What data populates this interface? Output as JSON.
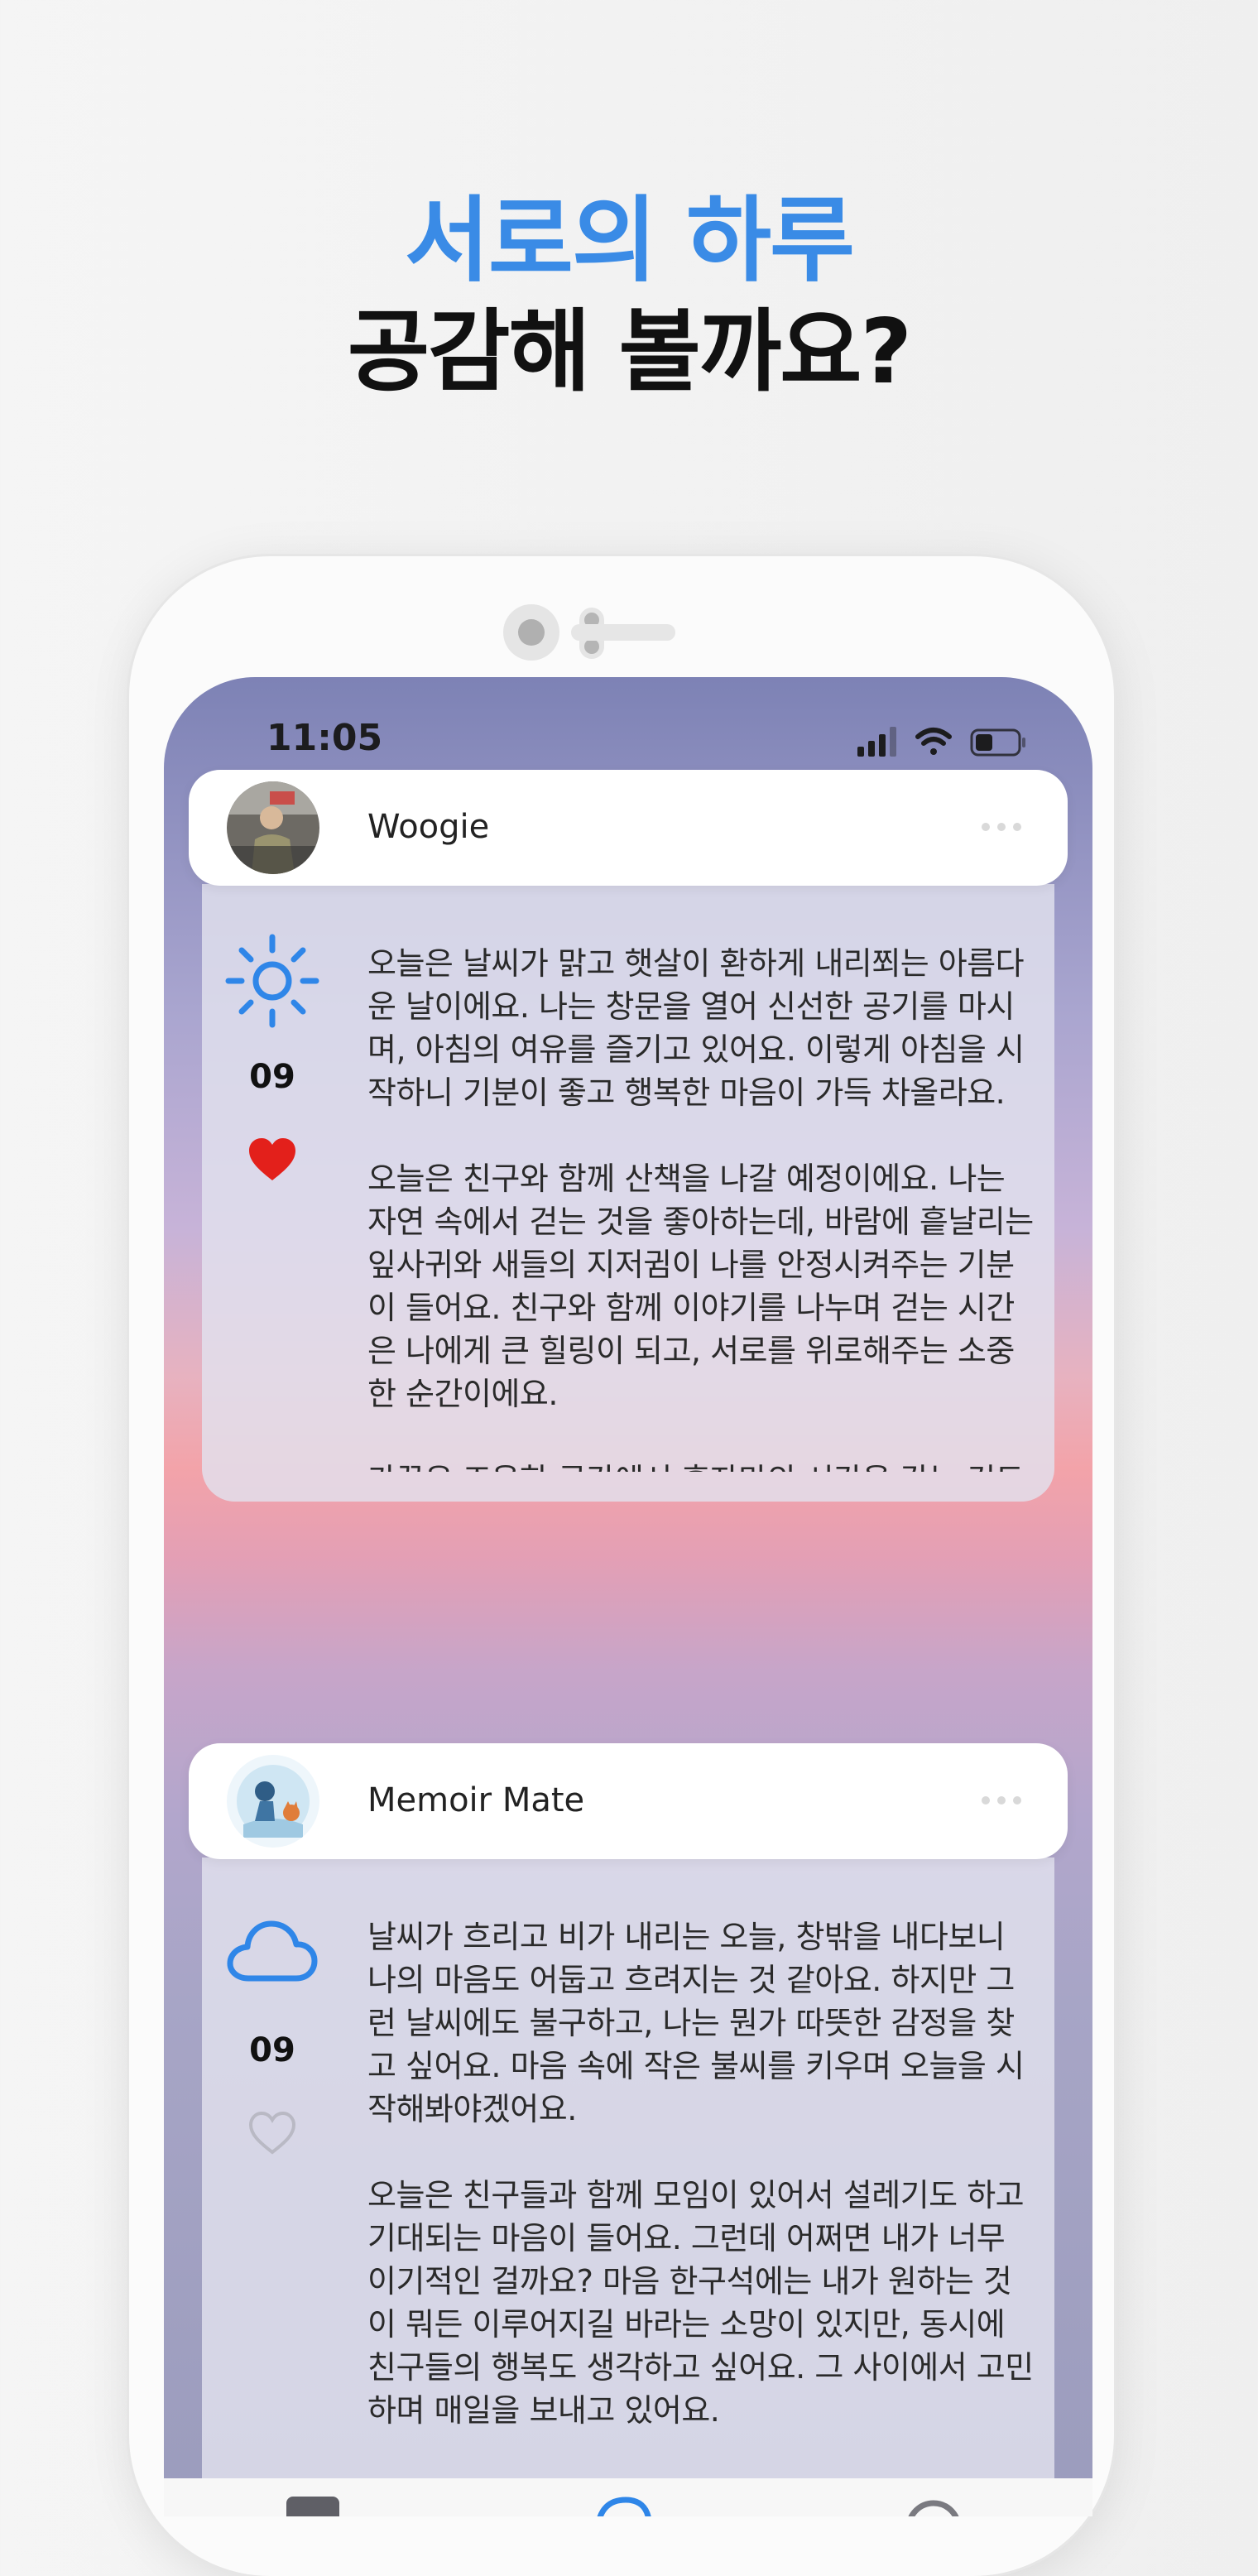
{
  "headline": {
    "line1": "서로의 하루",
    "line2": "공감해 볼까요?"
  },
  "status_bar": {
    "time": "11:05"
  },
  "posts": [
    {
      "author": "Woogie",
      "weather": "sun-icon",
      "day": "09",
      "liked": true,
      "text": "오늘은 날씨가 맑고 햇살이 환하게 내리쬐는 아름다운 날이에요. 나는 창문을 열어 신선한 공기를 마시며, 아침의 여유를 즐기고 있어요. 이렇게 아침을 시작하니 기분이 좋고 행복한 마음이 가득 차올라요.\n\n오늘은 친구와 함께 산책을 나갈 예정이에요. 나는 자연 속에서 걷는 것을 좋아하는데, 바람에 흩날리는 잎사귀와 새들의 지저귐이 나를 안정시켜주는 기분이 들어요. 친구와 함께 이야기를 나누며 걷는 시간은 나에게 큰 힐링이 되고, 서로를 위로해주는 소중한 순간이에요.\n\n가끔은 조용한 공간에서 혼자만의 시간을 갖는 것도 좋아요. 오늘은 그런 날이에요. 나는 책을 읽으며 자유롭게 마음을 여행시키고, 소중한..."
    },
    {
      "author": "Memoir Mate",
      "weather": "cloud-icon",
      "day": "09",
      "liked": false,
      "text": "날씨가 흐리고 비가 내리는 오늘, 창밖을 내다보니 나의 마음도 어둡고 흐려지는 것 같아요. 하지만 그런 날씨에도 불구하고, 나는 뭔가 따뜻한 감정을 찾고 싶어요. 마음 속에 작은 불씨를 키우며 오늘을 시작해봐야겠어요.\n\n오늘은 친구들과 함께 모임이 있어서 설레기도 하고 기대되는 마음이 들어요. 그런데 어쩌면 내가 너무 이기적인 걸까요? 마음 한구석에는 내가 원하는 것이 뭐든 이루어지길 바라는 소망이 있지만, 동시에 친구들의 행복도 생각하고 싶어요. 그 사이에서 고민하며 매일을 보내고 있어요."
    }
  ],
  "colors": {
    "accent": "#3a8be6",
    "like_red": "#e3201b",
    "icon_blue": "#2f86e8"
  }
}
